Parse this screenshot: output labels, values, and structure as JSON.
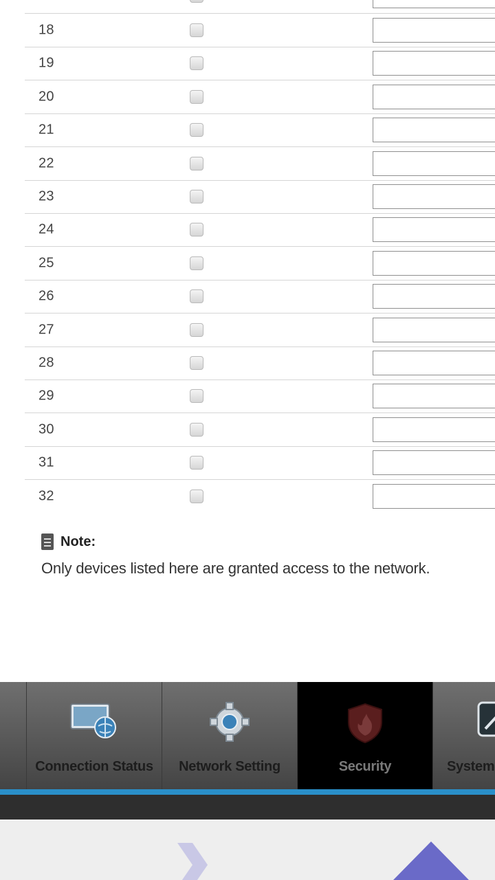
{
  "table": {
    "rows": [
      {
        "num": "18",
        "value": ""
      },
      {
        "num": "19",
        "value": ""
      },
      {
        "num": "20",
        "value": ""
      },
      {
        "num": "21",
        "value": ""
      },
      {
        "num": "22",
        "value": ""
      },
      {
        "num": "23",
        "value": ""
      },
      {
        "num": "24",
        "value": ""
      },
      {
        "num": "25",
        "value": ""
      },
      {
        "num": "26",
        "value": ""
      },
      {
        "num": "27",
        "value": ""
      },
      {
        "num": "28",
        "value": ""
      },
      {
        "num": "29",
        "value": ""
      },
      {
        "num": "30",
        "value": ""
      },
      {
        "num": "31",
        "value": ""
      },
      {
        "num": "32",
        "value": ""
      }
    ]
  },
  "note": {
    "title": "Note:",
    "text": "Only devices listed here are granted access to the network.",
    "icon": "document-icon"
  },
  "tabs": [
    {
      "label": "Connection Status",
      "icon": "monitor-globe-icon",
      "active": false
    },
    {
      "label": "Network Setting",
      "icon": "gear-icon",
      "active": false
    },
    {
      "label": "Security",
      "icon": "shield-icon",
      "active": true
    },
    {
      "label": "System",
      "icon": "system-tools-icon",
      "active": false
    }
  ],
  "footer": {
    "icons": [
      "chevron-right-icon",
      "scroll-up-arrow-icon"
    ]
  },
  "colors": {
    "accent_blue": "#2a8fc9",
    "tab_active_bg": "#000000",
    "arrow_purple": "#6a6ac8"
  }
}
